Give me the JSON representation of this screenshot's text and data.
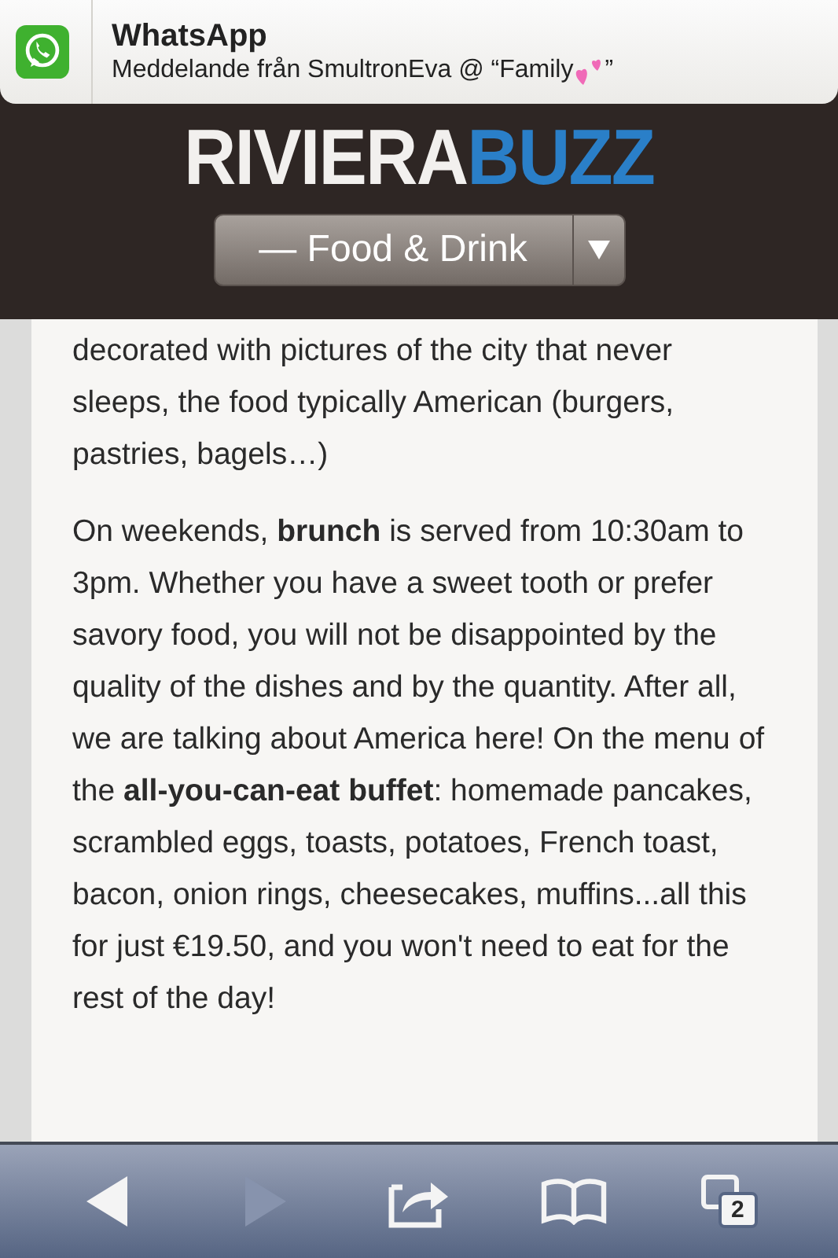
{
  "notification": {
    "app": "WhatsApp",
    "message": "Meddelande från SmultronEva @ “Family",
    "message_end": " ”"
  },
  "header": {
    "logo_main": "RIVIERA",
    "logo_accent": "BUZZ",
    "category_select": "— Food & Drink"
  },
  "article": {
    "paragraphs": [
      "decorated with pictures of the city that never sleeps, the food typically American (burgers, pastries, bagels…)",
      "On weekends, **brunch** is served from 10:30am to 3pm. Whether you have a sweet tooth or prefer savory food, you will not be disappointed by the quality of the dishes and by the quantity. After all, we are talking about America here! On the menu of the **all-you-can-eat buffet**: homemade pancakes, scrambled eggs, toasts, potatoes, French toast, bacon, onion rings, cheesecakes, muffins...all this for just €19.50, and you won't need to eat for the rest of the day!"
    ]
  },
  "toolbar": [
    {
      "kind": "back",
      "disabled": false
    },
    {
      "kind": "forward",
      "disabled": true
    },
    {
      "kind": "share",
      "disabled": false
    },
    {
      "kind": "bookmarks",
      "disabled": false
    },
    {
      "kind": "tabs",
      "disabled": false,
      "count": "2"
    }
  ]
}
